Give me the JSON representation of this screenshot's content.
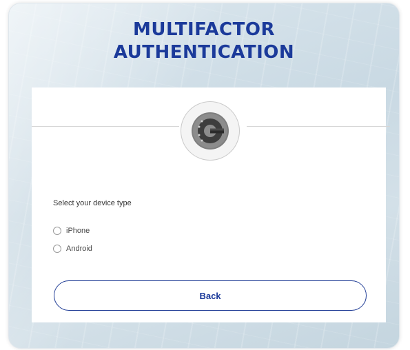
{
  "header": {
    "title_line1": "MULTIFACTOR",
    "title_line2": "AUTHENTICATION",
    "title_color": "#1b3a9a"
  },
  "card": {
    "logo": "google-authenticator-icon",
    "device_prompt": "Select your device type",
    "options": [
      {
        "label": "iPhone",
        "selected": false
      },
      {
        "label": "Android",
        "selected": false
      }
    ],
    "back_label": "Back"
  },
  "colors": {
    "accent": "#1f3c95",
    "card_background": "#ffffff",
    "divider": "#d6d6d6"
  }
}
